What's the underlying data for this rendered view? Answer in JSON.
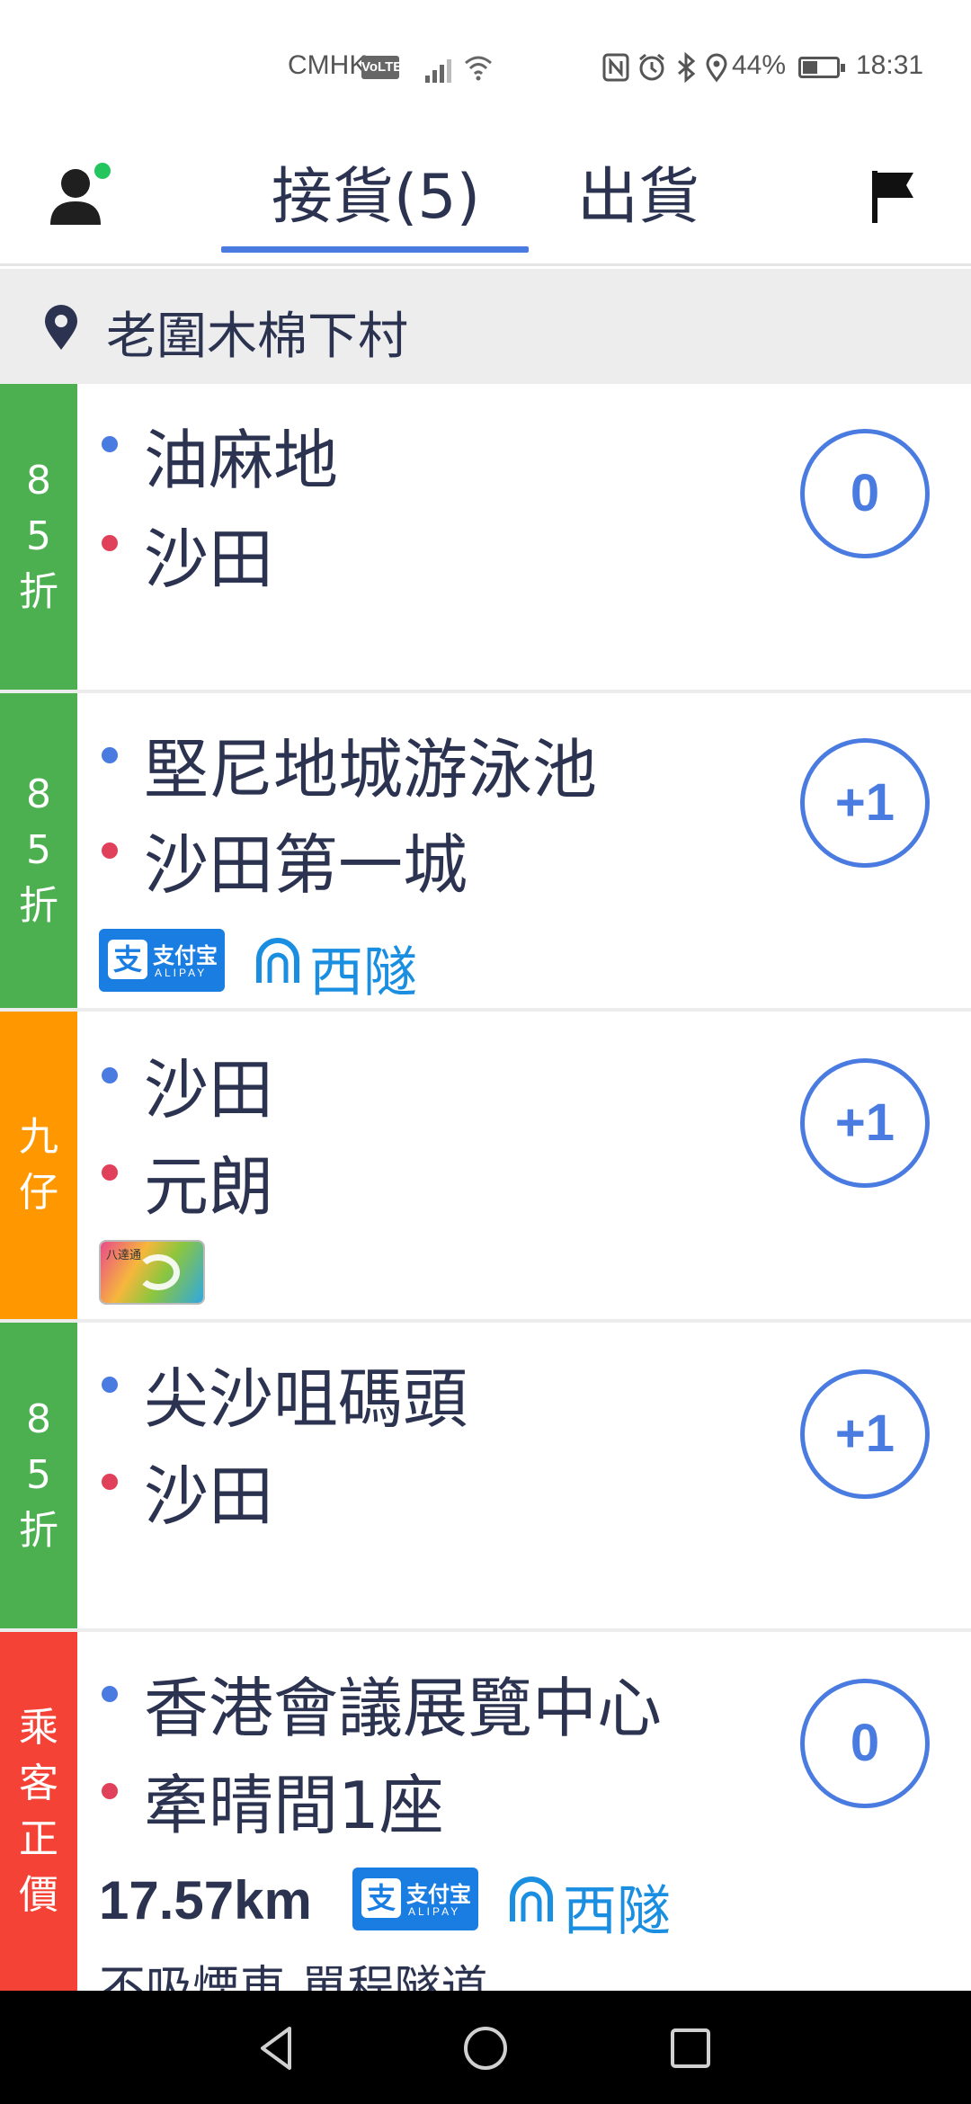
{
  "status_bar": {
    "carrier": "CMHK",
    "volte": "VoLTE",
    "battery_percent": "44%",
    "battery_level": 0.44,
    "time": "18:31"
  },
  "header": {
    "tabs": [
      {
        "label": "接貨(5)",
        "selected": true
      },
      {
        "label": "出貨",
        "selected": false
      }
    ],
    "accent_color": "#4a7be0"
  },
  "location": {
    "name": "老圍木棉下村"
  },
  "orders": [
    {
      "tag": [
        "8",
        "5",
        "折"
      ],
      "tag_color": "#4caf50",
      "from": "油麻地",
      "to": "沙田",
      "count": "0"
    },
    {
      "tag": [
        "8",
        "5",
        "折"
      ],
      "tag_color": "#4caf50",
      "from": "堅尼地城游泳池",
      "to": "沙田第一城",
      "count": "+1",
      "alipay": {
        "cn": "支付宝",
        "en": "ALIPAY"
      },
      "tunnel": "西隧"
    },
    {
      "tag": [
        "九",
        "仔"
      ],
      "tag_color": "#ff9800",
      "from": "沙田",
      "to": "元朗",
      "count": "+1",
      "octopus": "八達通"
    },
    {
      "tag": [
        "8",
        "5",
        "折"
      ],
      "tag_color": "#4caf50",
      "from": "尖沙咀碼頭",
      "to": "沙田",
      "count": "+1"
    },
    {
      "tag": [
        "乘",
        "客",
        "正",
        "價"
      ],
      "tag_color": "#f44336",
      "from": "香港會議展覽中心",
      "to": "牽晴間1座",
      "count": "0",
      "distance": "17.57km",
      "alipay": {
        "cn": "支付宝",
        "en": "ALIPAY"
      },
      "tunnel": "西隧",
      "note": "不吸煙車 單程隧道"
    }
  ],
  "icons": {
    "avatar": "person-icon",
    "online_status": "green-dot",
    "flag": "flag-icon",
    "location": "map-pin-icon",
    "back": "triangle-back-icon",
    "home": "circle-home-icon",
    "recents": "square-recents-icon"
  }
}
